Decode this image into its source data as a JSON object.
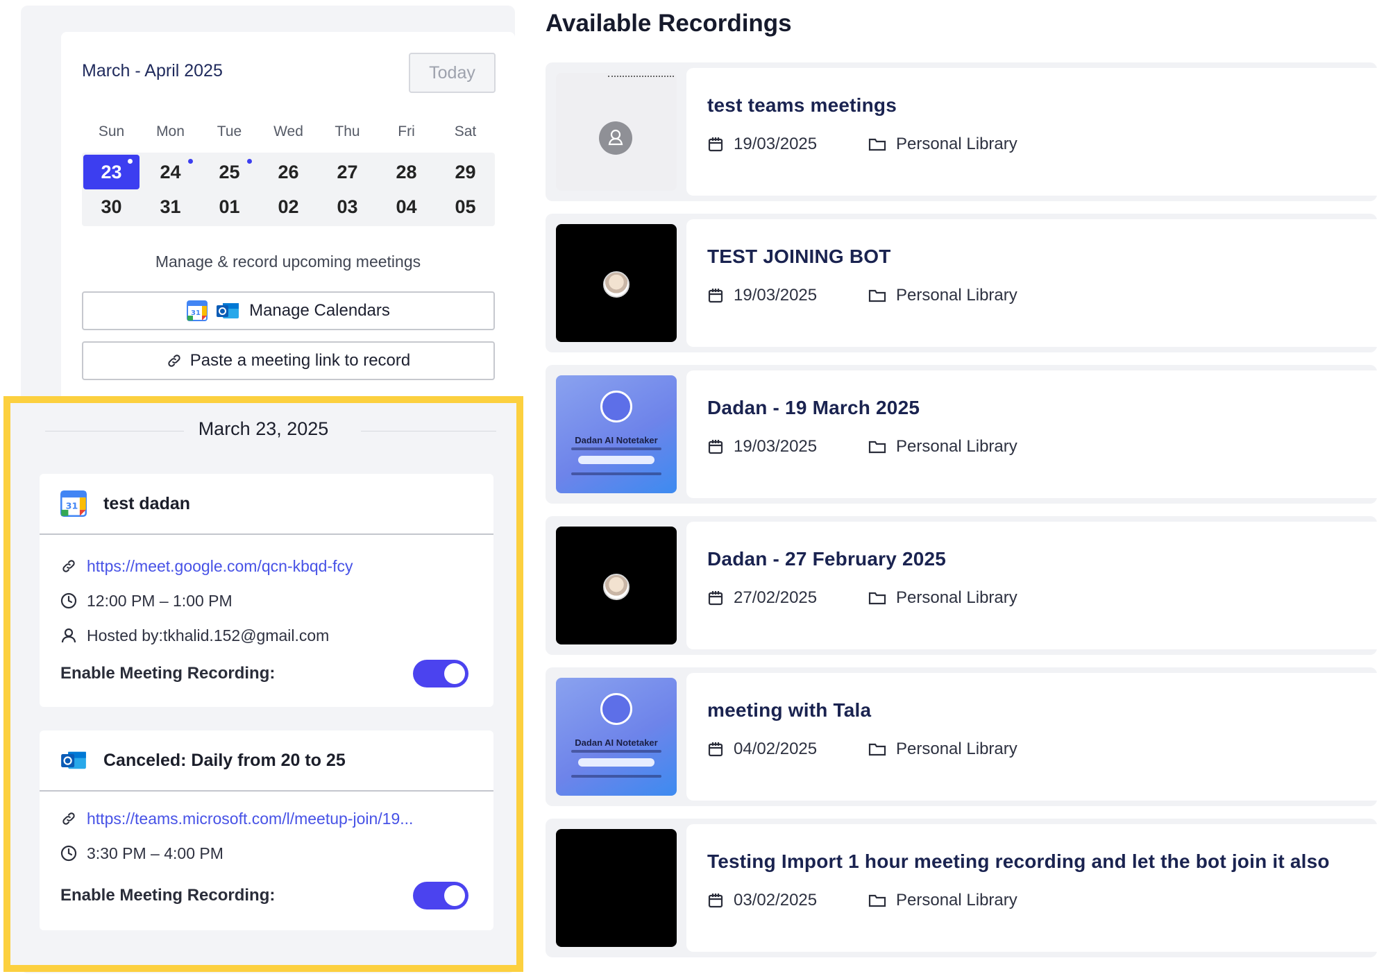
{
  "calendar": {
    "title": "March - April 2025",
    "today_label": "Today",
    "weekdays": [
      "Sun",
      "Mon",
      "Tue",
      "Wed",
      "Thu",
      "Fri",
      "Sat"
    ],
    "days": [
      "23",
      "24",
      "25",
      "26",
      "27",
      "28",
      "29",
      "30",
      "31",
      "01",
      "02",
      "03",
      "04",
      "05"
    ],
    "selected_day": "23",
    "days_with_events": [
      "23",
      "24",
      "25"
    ],
    "accent_color": "#3c3ef0",
    "manage_text": "Manage & record upcoming meetings",
    "manage_calendars_label": "Manage Calendars",
    "paste_link_label": "Paste a meeting link to record"
  },
  "schedule": {
    "date_heading": "March 23, 2025",
    "highlight_color": "#fcd03f",
    "events": [
      {
        "title": "test dadan",
        "provider_icon": "google-calendar-icon",
        "link": "https://meet.google.com/qcn-kbqd-fcy",
        "time": "12:00 PM – 1:00 PM",
        "host": "Hosted by:tkhalid.152@gmail.com",
        "recording_label": "Enable Meeting Recording:",
        "recording_enabled": true
      },
      {
        "title": "Canceled: Daily from 20 to 25",
        "provider_icon": "outlook-calendar-icon",
        "link": "https://teams.microsoft.com/l/meetup-join/19...",
        "time": "3:30 PM – 4:00 PM",
        "recording_label": "Enable Meeting Recording:",
        "recording_enabled": true
      }
    ]
  },
  "recordings": {
    "title": "Available Recordings",
    "items": [
      {
        "name": "test teams meetings",
        "date": "19/03/2025",
        "library": "Personal Library",
        "thumbnail": "grey-avatar"
      },
      {
        "name": "TEST JOINING BOT",
        "date": "19/03/2025",
        "library": "Personal Library",
        "thumbnail": "black-avatar"
      },
      {
        "name": "Dadan - 19 March 2025",
        "date": "19/03/2025",
        "library": "Personal Library",
        "thumbnail": "notetaker",
        "brand": "Dadan AI Notetaker"
      },
      {
        "name": "Dadan - 27 February 2025",
        "date": "27/02/2025",
        "library": "Personal Library",
        "thumbnail": "black-avatar"
      },
      {
        "name": "meeting with Tala",
        "date": "04/02/2025",
        "library": "Personal Library",
        "thumbnail": "notetaker",
        "brand": "Dadan AI Notetaker"
      },
      {
        "name": "Testing Import 1 hour meeting recording and let the bot join it also",
        "date": "03/02/2025",
        "library": "Personal Library",
        "thumbnail": "black"
      }
    ]
  }
}
